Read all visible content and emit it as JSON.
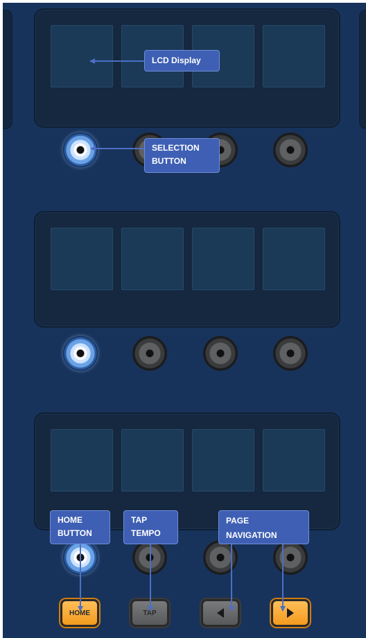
{
  "callouts": {
    "lcd_display": "LCD Display",
    "selection_button": [
      "SELECTION",
      "BUTTON"
    ],
    "home_button": [
      "HOME",
      "BUTTON"
    ],
    "tap_tempo": [
      "TAP",
      "TEMPO"
    ],
    "page_navigation": "PAGE NAVIGATION"
  },
  "buttons": {
    "home": "HOME",
    "tap": "TAP",
    "page_prev_icon": "left-triangle-icon",
    "page_next_icon": "right-triangle-icon"
  },
  "colors": {
    "background": "#18335b",
    "panel": "#15283f",
    "lcd_cell": "#1b3a58",
    "callout": "#3e5fb3",
    "home_button": "#f7a632",
    "selection_active": "#6aa2e6"
  }
}
